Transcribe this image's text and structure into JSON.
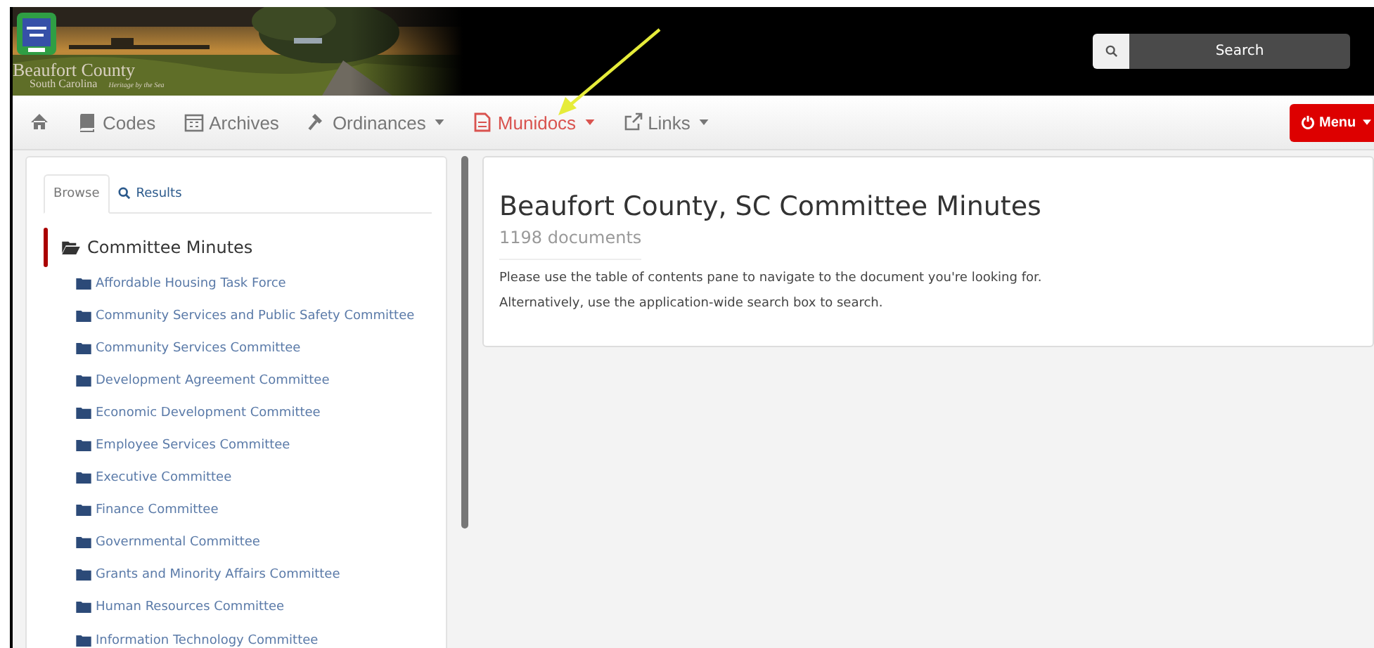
{
  "header": {
    "brand": "Beaufort County",
    "subtitle": "South Carolina",
    "tagline": "Heritage by the Sea",
    "search": {
      "button": "Search"
    }
  },
  "nav": {
    "items": [
      {
        "kind": "home",
        "dropdown": false,
        "selected": false
      },
      {
        "kind": "book",
        "label": "Codes",
        "dropdown": false,
        "selected": false
      },
      {
        "kind": "calendar",
        "label": "Archives",
        "dropdown": false,
        "selected": false
      },
      {
        "kind": "gavel",
        "label": "Ordinances",
        "dropdown": true,
        "selected": false
      },
      {
        "kind": "file",
        "label": "Munidocs",
        "dropdown": true,
        "selected": true
      },
      {
        "kind": "external",
        "label": "Links",
        "dropdown": true,
        "selected": false
      }
    ],
    "menu": "Menu"
  },
  "sidebar": {
    "tabs": [
      {
        "label": "Browse",
        "icon": false,
        "selected": true
      },
      {
        "label": "Results",
        "icon": true,
        "selected": false
      }
    ],
    "tree": {
      "label": "Committee Minutes",
      "expanded": true,
      "children": [
        {
          "label": "Affordable Housing Task Force"
        },
        {
          "label": "Community Services and Public Safety Committee"
        },
        {
          "label": "Community Services Committee"
        },
        {
          "label": "Development Agreement Committee"
        },
        {
          "label": "Economic Development Committee"
        },
        {
          "label": "Employee Services Committee"
        },
        {
          "label": "Executive Committee"
        },
        {
          "label": "Finance Committee"
        },
        {
          "label": "Governmental Committee"
        },
        {
          "label": "Grants and Minority Affairs Committee"
        },
        {
          "label": "Human Resources Committee"
        },
        {
          "label": "Information Technology Committee"
        }
      ]
    }
  },
  "main": {
    "title": "Beaufort County, SC Committee Minutes",
    "count": "1198 documents",
    "paragraphs": [
      "Please use the table of contents pane to navigate to the document you're looking for.",
      "Alternatively, use the application-wide search box to search."
    ]
  }
}
